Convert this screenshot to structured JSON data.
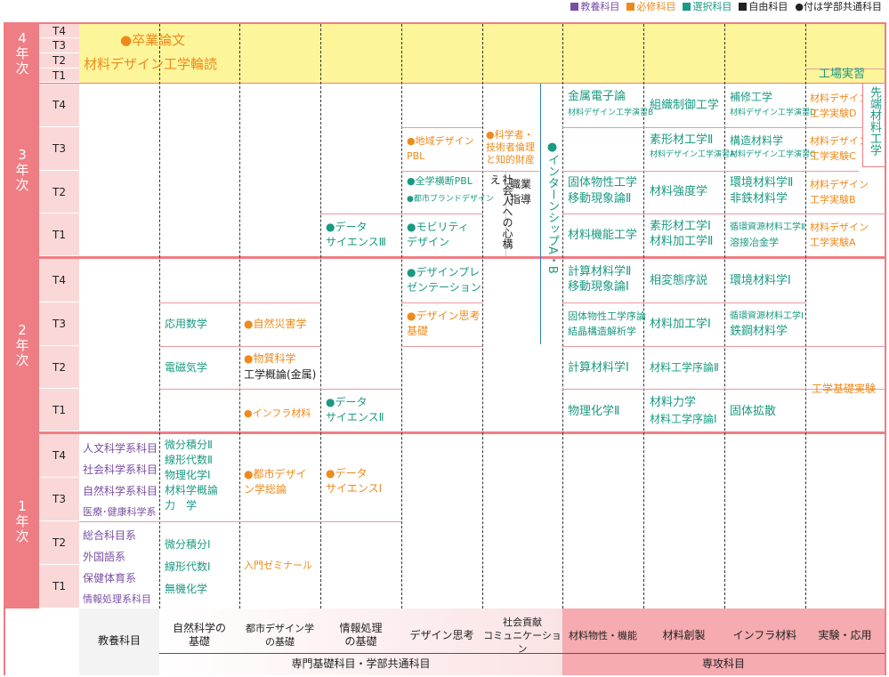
{
  "legend": {
    "general": "教養科目",
    "required": "必修科目",
    "elective": "選択科目",
    "free": "自由科目",
    "common_note": "●付は学部共通科目",
    "colors": {
      "general": "#7a4ea3",
      "required": "#ee8a1c",
      "elective": "#1a9a82",
      "free": "#222222"
    }
  },
  "years": {
    "y4": [
      "4",
      "年",
      "次"
    ],
    "y3": [
      "3",
      "年",
      "次"
    ],
    "y2": [
      "2",
      "年",
      "次"
    ],
    "y1": [
      "1",
      "年",
      "次"
    ]
  },
  "terms": {
    "y4": [
      "T4",
      "T3",
      "T2",
      "T1"
    ],
    "y3": [
      "T4",
      "T3",
      "T2",
      "T1"
    ],
    "y2": [
      "T4",
      "T3",
      "T2",
      "T1"
    ],
    "y1": [
      "T4",
      "T3",
      "T2",
      "T1"
    ]
  },
  "year4": {
    "thesis": "●卒業論文",
    "reading": "材料デザイン工学輪読",
    "factory": "工場実習"
  },
  "general_courses": {
    "y1_upper": [
      "人文科学系科目",
      "社会科学系科目",
      "自然科学系科目",
      "医療･健康科学系"
    ],
    "y1_lower": [
      "総合科目系",
      "外国語系",
      "保健体育系",
      "情報処理系科目"
    ]
  },
  "natsci": {
    "y2_t3": "応用数学",
    "y2_t2": "電磁気学",
    "y1_upper": [
      "微分積分Ⅱ",
      "線形代数Ⅱ",
      "物理化学Ⅰ",
      "材料学概論",
      "力　学"
    ],
    "y1_lower": [
      "微分積分Ⅰ",
      "線形代数Ⅰ",
      "無機化学"
    ]
  },
  "urban": {
    "y2_t3": "●自然災害学",
    "y2_t2a": "●物質科学",
    "y2_t2b": "工学概論(金属)",
    "y2_t1": "●インフラ材料",
    "y1_upper": [
      "●都市デザイ",
      "ン学総論"
    ],
    "y1_lower": "入門ゼミナール"
  },
  "info": {
    "y3_t1": [
      "●データ",
      "サイエンスⅢ"
    ],
    "y2_t1": [
      "●データ",
      "サイエンスⅡ"
    ],
    "y1": [
      "●データ",
      "サイエンスⅠ"
    ]
  },
  "design": {
    "y3_t3": [
      "●地域デザイン",
      "PBL"
    ],
    "y3_t2a": "●全学横断PBL",
    "y3_t2b": "●都市ブランドデザイン",
    "y3_t1": [
      "●モビリティ",
      "デザイン"
    ],
    "y2_t4": [
      "●デザインプレ",
      "ゼンテーション"
    ],
    "y2_t3": [
      "●デザイン思考",
      "基礎"
    ]
  },
  "social": {
    "ethics": [
      "●科学者・",
      "技術者倫理",
      "と知的財産"
    ],
    "society": "社会人への心構え",
    "career": [
      "職業",
      "指導"
    ],
    "intern": "●インターンシップA・B"
  },
  "matprop": {
    "y3_t4a": "金属電子論",
    "y3_t4b": "材料デザイン工学演習B",
    "y3_t2a": "固体物性工学",
    "y3_t2b": "移動現象論Ⅱ",
    "y3_t1": "材料機能工学",
    "y2_t4a": "計算材料学Ⅱ",
    "y2_t4b": "移動現象論Ⅰ",
    "y2_t3a": "固体物性工学序論",
    "y2_t3b": "結晶構造解析学",
    "y2_t2": "計算材料学Ⅰ",
    "y2_t1": "物理化学Ⅱ"
  },
  "matcreate": {
    "y3_t4": "組織制御工学",
    "y3_t3a": "素形材工学Ⅱ",
    "y3_t3b": "材料デザイン工学演習A",
    "y3_t2": "材料強度学",
    "y3_t1a": "素形材工学Ⅰ",
    "y3_t1b": "材料加工学Ⅱ",
    "y2_t4": "相変態序説",
    "y2_t3": "材料加工学Ⅰ",
    "y2_t2": "材料工学序論Ⅱ",
    "y2_t1a": "材料力学",
    "y2_t1b": "材料工学序論Ⅰ"
  },
  "infra": {
    "y3_t4a": "補修工学",
    "y3_t4b": "材料デザイン工学演習D",
    "y3_t3a": "構造材料学",
    "y3_t3b": "材料デザイン工学演習C",
    "y3_t2a": "環境材料学Ⅱ",
    "y3_t2b": "非鉄材料学",
    "y3_t1a": "循環資源材料工学Ⅱ",
    "y3_t1b": "溶接冶金学",
    "y2_t4": "環境材料学Ⅰ",
    "y2_t3a": "循環資源材料工学Ⅰ",
    "y2_t3b": "鉄鋼材料学",
    "y2_t1": "固体拡散"
  },
  "lab": {
    "d": [
      "材料デザイン",
      "工学実験D"
    ],
    "c": [
      "材料デザイン",
      "工学実験C"
    ],
    "b": [
      "材料デザイン",
      "工学実験B"
    ],
    "a": [
      "材料デザイン",
      "工学実験A"
    ],
    "basic": "工学基礎実験",
    "advanced": "先端材料工学"
  },
  "footer": {
    "general": "教養科目",
    "natsci": [
      "自然科学の",
      "基礎"
    ],
    "urban": [
      "都市デザイン学",
      "の基礎"
    ],
    "info": [
      "情報処理",
      "の基礎"
    ],
    "design": "デザイン思考",
    "social": [
      "社会貢献",
      "コミュニケーション"
    ],
    "matprop": "材料物性・機能",
    "matcreate": "材料創製",
    "infra": "インフラ材料",
    "lab": "実験・応用",
    "specialized_basic": "専門基礎科目・学部共通科目",
    "major": "専攻科目"
  }
}
